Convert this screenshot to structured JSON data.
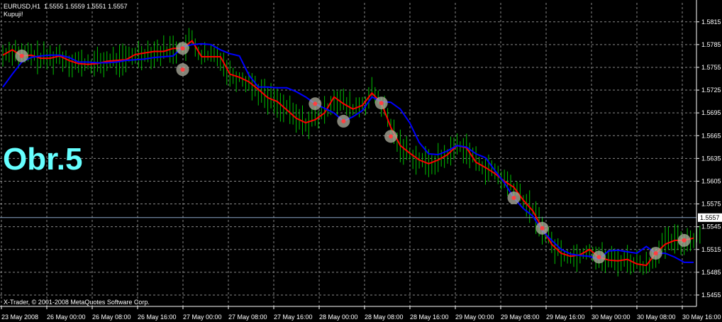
{
  "header": {
    "symbol": "EURUSD,H1",
    "ohlc": "1.5555 1.5559 1.5551 1.5557",
    "indicator": "Kupuji!"
  },
  "overlay_label": "Obr.5",
  "copyright": "X-Trader, © 2001-2008 MetaQuotes Software Corp.",
  "current_price_label": "1.5557",
  "colors": {
    "background": "#000000",
    "grid": "#ffffff",
    "axis": "#ffffff",
    "bars": "#00c000",
    "red_line": "#ff0000",
    "blue_line": "#0000ff",
    "price_line": "#8aa4c8",
    "label_text": "#66ffff",
    "dotted_level": "#4060ff"
  },
  "chart_data": {
    "type": "line",
    "title": "EURUSD,H1",
    "ylim": [
      1.544,
      1.584
    ],
    "y_ticks": [
      "1.5815",
      "1.5785",
      "1.5755",
      "1.5725",
      "1.5695",
      "1.5665",
      "1.5635",
      "1.5605",
      "1.5575",
      "1.5545",
      "1.5515",
      "1.5485",
      "1.5455"
    ],
    "x_ticks": [
      "23 May 2008",
      "26 May 00:00",
      "26 May 08:00",
      "26 May 16:00",
      "27 May 00:00",
      "27 May 08:00",
      "27 May 16:00",
      "28 May 00:00",
      "28 May 08:00",
      "28 May 16:00",
      "29 May 00:00",
      "29 May 08:00",
      "29 May 16:00",
      "30 May 00:00",
      "30 May 08:00",
      "30 May 16:00"
    ],
    "grid": true,
    "current_price": 1.5557,
    "series": [
      {
        "values": [
          1.5771,
          1.5778,
          1.577,
          1.5771,
          1.5767,
          1.5767,
          1.577,
          1.5764,
          1.576,
          1.5759,
          1.576,
          1.5763,
          1.5764,
          1.5765,
          1.5772,
          1.5774,
          1.5776,
          1.5776,
          1.578,
          1.578,
          1.579,
          1.5769,
          1.5769,
          1.5769,
          1.5746,
          1.5742,
          1.5736,
          1.5726,
          1.5715,
          1.571,
          1.5699,
          1.5688,
          1.5682,
          1.5686,
          1.5695,
          1.5716,
          1.5707,
          1.57,
          1.5705,
          1.5721,
          1.5708,
          1.5676,
          1.5652,
          1.5642,
          1.5633,
          1.5628,
          1.5633,
          1.564,
          1.5652,
          1.5649,
          1.563,
          1.5623,
          1.5615,
          1.5605,
          1.5597,
          1.558,
          1.5566,
          1.5543,
          1.5522,
          1.551,
          1.5506,
          1.5508,
          1.5515,
          1.5505,
          1.5501,
          1.55,
          1.5502,
          1.5496,
          1.5494,
          1.551,
          1.5522,
          1.5527,
          1.5527,
          1.553
        ]
      },
      {
        "values": [
          1.5729,
          1.5746,
          1.5762,
          1.5768,
          1.577,
          1.5771,
          1.5771,
          1.5768,
          1.5762,
          1.5762,
          1.5761,
          1.5761,
          1.5762,
          1.5764,
          1.5765,
          1.5766,
          1.5768,
          1.5769,
          1.577,
          1.5782,
          1.5785,
          1.5786,
          1.5785,
          1.5778,
          1.5773,
          1.577,
          1.5745,
          1.5729,
          1.5729,
          1.5728,
          1.5728,
          1.5723,
          1.5716,
          1.5707,
          1.5701,
          1.5695,
          1.5684,
          1.569,
          1.5698,
          1.5716,
          1.571,
          1.5709,
          1.57,
          1.5682,
          1.5656,
          1.5641,
          1.564,
          1.5645,
          1.5652,
          1.565,
          1.5641,
          1.5636,
          1.5619,
          1.5603,
          1.5583,
          1.5569,
          1.5559,
          1.554,
          1.5527,
          1.5515,
          1.5509,
          1.5507,
          1.5506,
          1.5502,
          1.5513,
          1.5514,
          1.5512,
          1.551,
          1.5519,
          1.551,
          1.551,
          1.5505,
          1.5498,
          1.5498
        ]
      }
    ]
  }
}
